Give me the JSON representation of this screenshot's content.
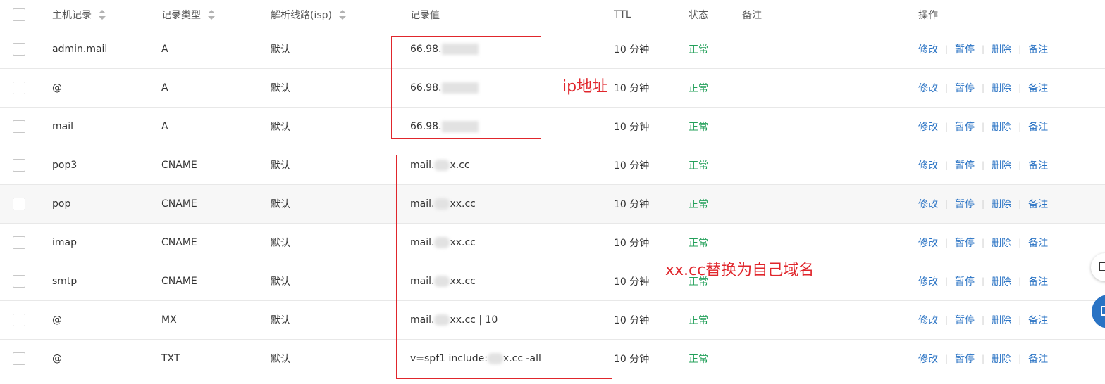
{
  "header": {
    "host": "主机记录",
    "type": "记录类型",
    "line": "解析线路(isp)",
    "value": "记录值",
    "ttl": "TTL",
    "status": "状态",
    "remark": "备注",
    "ops": "操作"
  },
  "ops": {
    "edit": "修改",
    "pause": "暂停",
    "delete": "删除",
    "remark": "备注",
    "sep": "|"
  },
  "rows": [
    {
      "host": "admin.mail",
      "type": "A",
      "line": "默认",
      "value_prefix": "66.98.",
      "value_suffix": "",
      "ttl": "10 分钟",
      "status": "正常"
    },
    {
      "host": "@",
      "type": "A",
      "line": "默认",
      "value_prefix": "66.98.",
      "value_suffix": "",
      "ttl": "10 分钟",
      "status": "正常"
    },
    {
      "host": "mail",
      "type": "A",
      "line": "默认",
      "value_prefix": "66.98.",
      "value_suffix": "",
      "ttl": "10 分钟",
      "status": "正常"
    },
    {
      "host": "pop3",
      "type": "CNAME",
      "line": "默认",
      "value_prefix": "mail.",
      "value_suffix": "x.cc",
      "ttl": "10 分钟",
      "status": "正常"
    },
    {
      "host": "pop",
      "type": "CNAME",
      "line": "默认",
      "value_prefix": "mail.",
      "value_suffix": "xx.cc",
      "ttl": "10 分钟",
      "status": "正常"
    },
    {
      "host": "imap",
      "type": "CNAME",
      "line": "默认",
      "value_prefix": "mail.",
      "value_suffix": "xx.cc",
      "ttl": "10 分钟",
      "status": "正常"
    },
    {
      "host": "smtp",
      "type": "CNAME",
      "line": "默认",
      "value_prefix": "mail.",
      "value_suffix": "xx.cc",
      "ttl": "10 分钟",
      "status": "正常"
    },
    {
      "host": "@",
      "type": "MX",
      "line": "默认",
      "value_prefix": "mail.",
      "value_suffix": "xx.cc | 10",
      "ttl": "10 分钟",
      "status": "正常"
    },
    {
      "host": "@",
      "type": "TXT",
      "line": "默认",
      "value_prefix": "v=spf1 include:",
      "value_suffix": "x.cc -all",
      "ttl": "10 分钟",
      "status": "正常"
    }
  ],
  "annotations": {
    "ip_label": "ip地址",
    "domain_label": "xx.cc替换为自己域名"
  },
  "colors": {
    "link": "#2a73c4",
    "status_ok": "#23a05a",
    "annotation": "#e0262c"
  }
}
